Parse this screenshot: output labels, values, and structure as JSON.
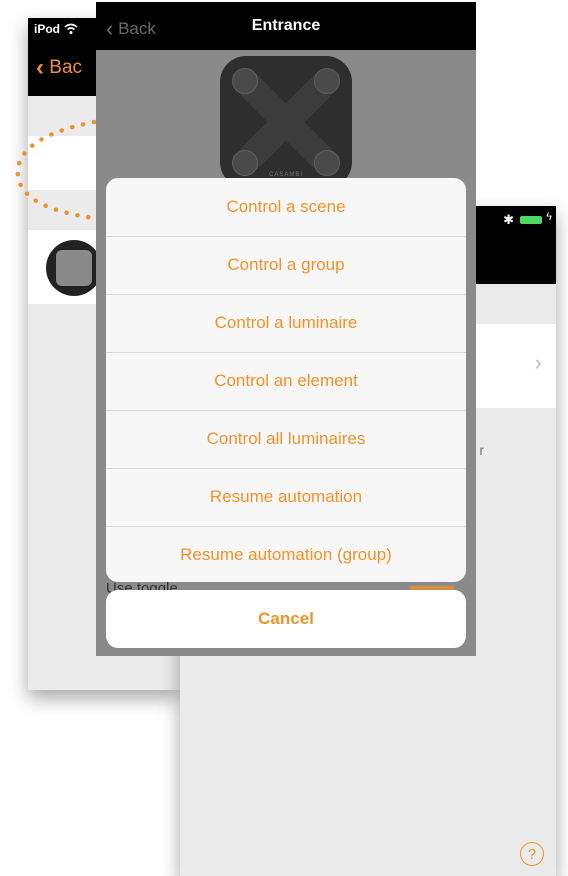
{
  "left_screen": {
    "carrier": "iPod",
    "back_label": "Bac"
  },
  "right_screen": {
    "fragment": "r",
    "chevron": "›",
    "help": "?"
  },
  "front_screen": {
    "back_label": "Back",
    "title": "Entrance",
    "device_brand": "CASAMBI"
  },
  "action_sheet": {
    "items": [
      "Control a scene",
      "Control a group",
      "Control a luminaire",
      "Control an element",
      "Control all luminaires",
      "Resume automation",
      "Resume automation (group)"
    ],
    "cancel": "Cancel"
  },
  "background_row": {
    "label": "Use toggle"
  },
  "colors": {
    "accent": "#f0922a",
    "sheet_bg": "#f7f7f7",
    "dim_bg": "#8a8a8a"
  },
  "icons": {
    "wifi": "wifi-icon",
    "bluetooth": "bluetooth-icon",
    "battery": "battery-icon",
    "help": "help-icon",
    "chevron": "chevron-right-icon"
  }
}
